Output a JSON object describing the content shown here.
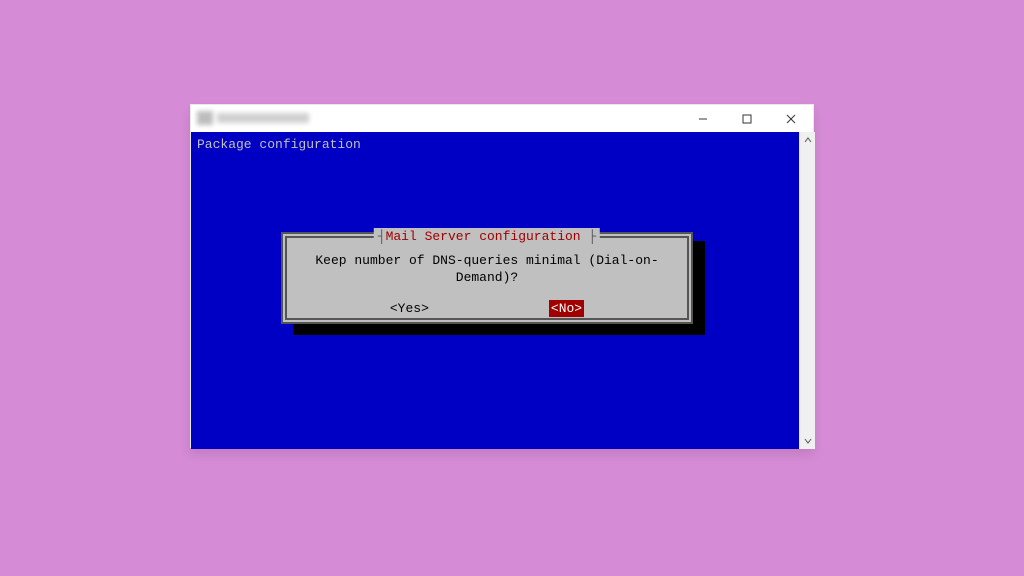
{
  "colors": {
    "page_bg": "#d58bd5",
    "terminal_bg": "#0000c4",
    "dialog_bg": "#c0c0c0",
    "accent_red": "#a00000"
  },
  "window": {
    "controls": {
      "minimize": "minimize",
      "maximize": "maximize",
      "close": "close"
    }
  },
  "terminal": {
    "header": "Package configuration"
  },
  "dialog": {
    "title": "Mail Server configuration",
    "question": "Keep number of DNS-queries minimal (Dial-on-Demand)?",
    "yes": "<Yes>",
    "no": "<No>",
    "selected": "no"
  }
}
